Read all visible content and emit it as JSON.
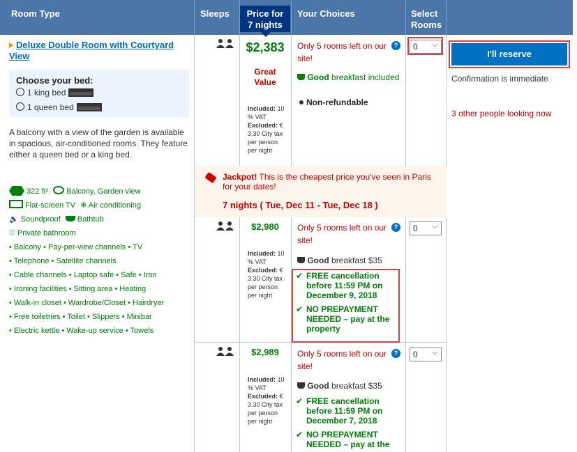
{
  "header": {
    "room_type": "Room Type",
    "sleeps": "Sleeps",
    "price_line1": "Price for",
    "price_line2": "7 nights",
    "your_choices": "Your Choices",
    "select_line1": "Select",
    "select_line2": "Rooms"
  },
  "room": {
    "title": "Deluxe Double Room with Courtyard View",
    "choose_bed": "Choose your bed:",
    "bed1": "1 king bed",
    "bed2": "1 queen bed",
    "description": "A balcony with a view of the garden is available in spacious, air-conditioned rooms. They feature either a queen bed or a king bed.",
    "size": "322 ft²",
    "balcony_view": "Balcony, Garden view",
    "tv": "Flat-screen TV",
    "ac": "Air conditioning",
    "soundproof": "Soundproof",
    "bathtub": "Bathtub",
    "bathroom": "Private bathroom",
    "facilities_line1": "• Balcony  • Pay-per-view channels  • TV",
    "facilities_line2": "• Telephone  • Satellite channels",
    "facilities_line3": "• Cable channels  • Laptop safe  • Safe  • Iron",
    "facilities_line4": "• Ironing facilities  • Sitting area  • Heating",
    "facilities_line5": "• Walk-in closet  • Wardrobe/Closet  • Hairdryer",
    "facilities_line6": "• Free toiletries  • Toilet  • Slippers  • Minibar",
    "facilities_line7": "• Electric kettle  • Wake-up service  • Towels"
  },
  "offers": [
    {
      "price": "$2,383",
      "deal": "Great Value",
      "included_label": "Included:",
      "included": "10 % VAT",
      "excluded_label": "Excluded:",
      "excluded": "€ 3.30 City tax per person per night",
      "rooms_left": "Only 5 rooms left on our site!",
      "breakfast_good": "Good",
      "breakfast_rest": "breakfast included",
      "policy": "Non-refundable",
      "select_value": "0"
    },
    {
      "price": "$2,980",
      "included_label": "Included:",
      "included": "10 % VAT",
      "excluded_label": "Excluded:",
      "excluded": "€ 3.30 City tax per person per night",
      "rooms_left": "Only 5 rooms left on our site!",
      "breakfast_good": "Good",
      "breakfast_rest": "breakfast $35",
      "cancel": "FREE cancellation before 11:59 PM on December 9, 2018",
      "prepay": "NO PREPAYMENT NEEDED – pay at the property",
      "select_value": "0"
    },
    {
      "price": "$2,989",
      "included_label": "Included:",
      "included": "10 % VAT",
      "excluded_label": "Excluded:",
      "excluded": "€ 3.30 City tax per person per night",
      "rooms_left": "Only 5 rooms left on our site!",
      "breakfast_good": "Good",
      "breakfast_rest": "breakfast $35",
      "cancel": "FREE cancellation before 11:59 PM on December 7, 2018",
      "prepay": "NO PREPAYMENT NEEDED – pay at the",
      "select_value": "0"
    }
  ],
  "jackpot": {
    "bold": "Jackpot!",
    "text": "This is the cheapest price you've seen in Paris for your dates!",
    "dates": "7 nights ( Tue, Dec 11 - Tue, Dec 18 )"
  },
  "reserve": {
    "button": "I'll reserve",
    "confirmation": "Confirmation is immediate",
    "looking": "3 other people looking now"
  },
  "colors": {
    "header_bg": "#4a76a8",
    "price_header_bg": "#003580",
    "button_bg": "#0071c2",
    "green": "#008009",
    "red": "#cc0000",
    "highlight_box": "#d0454c"
  }
}
